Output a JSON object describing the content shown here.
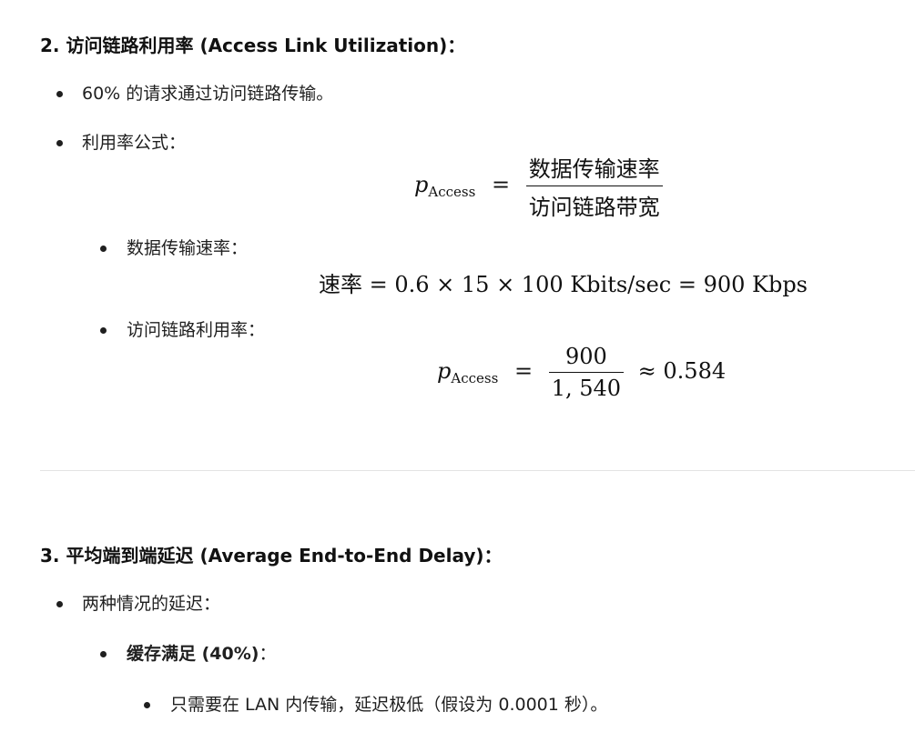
{
  "section2": {
    "heading": "2. 访问链路利用率 (Access Link Utilization)：",
    "bullet1": "60% 的请求通过访问链路传输。",
    "bullet2": "利用率公式：",
    "formula1": {
      "lhs_var": "p",
      "lhs_sub": "Access",
      "eq": "=",
      "numerator": "数据传输速率",
      "denominator": "访问链路带宽"
    },
    "sub_bullet1": "数据传输速率：",
    "formula2": "速率 = 0.6 × 15 × 100 Kbits/sec = 900 Kbps",
    "sub_bullet2": "访问链路利用率：",
    "formula3": {
      "lhs_var": "p",
      "lhs_sub": "Access",
      "eq": "=",
      "numerator": "900",
      "denominator": "1, 540",
      "approx": "≈ 0.584"
    }
  },
  "section3": {
    "heading": "3. 平均端到端延迟 (Average End-to-End Delay)：",
    "bullet1": "两种情况的延迟：",
    "sub_bullet1_bold": "缓存满足 (40%)",
    "sub_bullet1_rest": "：",
    "sub_sub_bullet1": "只需要在 LAN 内传输，延迟极低（假设为 0.0001 秒）。"
  }
}
